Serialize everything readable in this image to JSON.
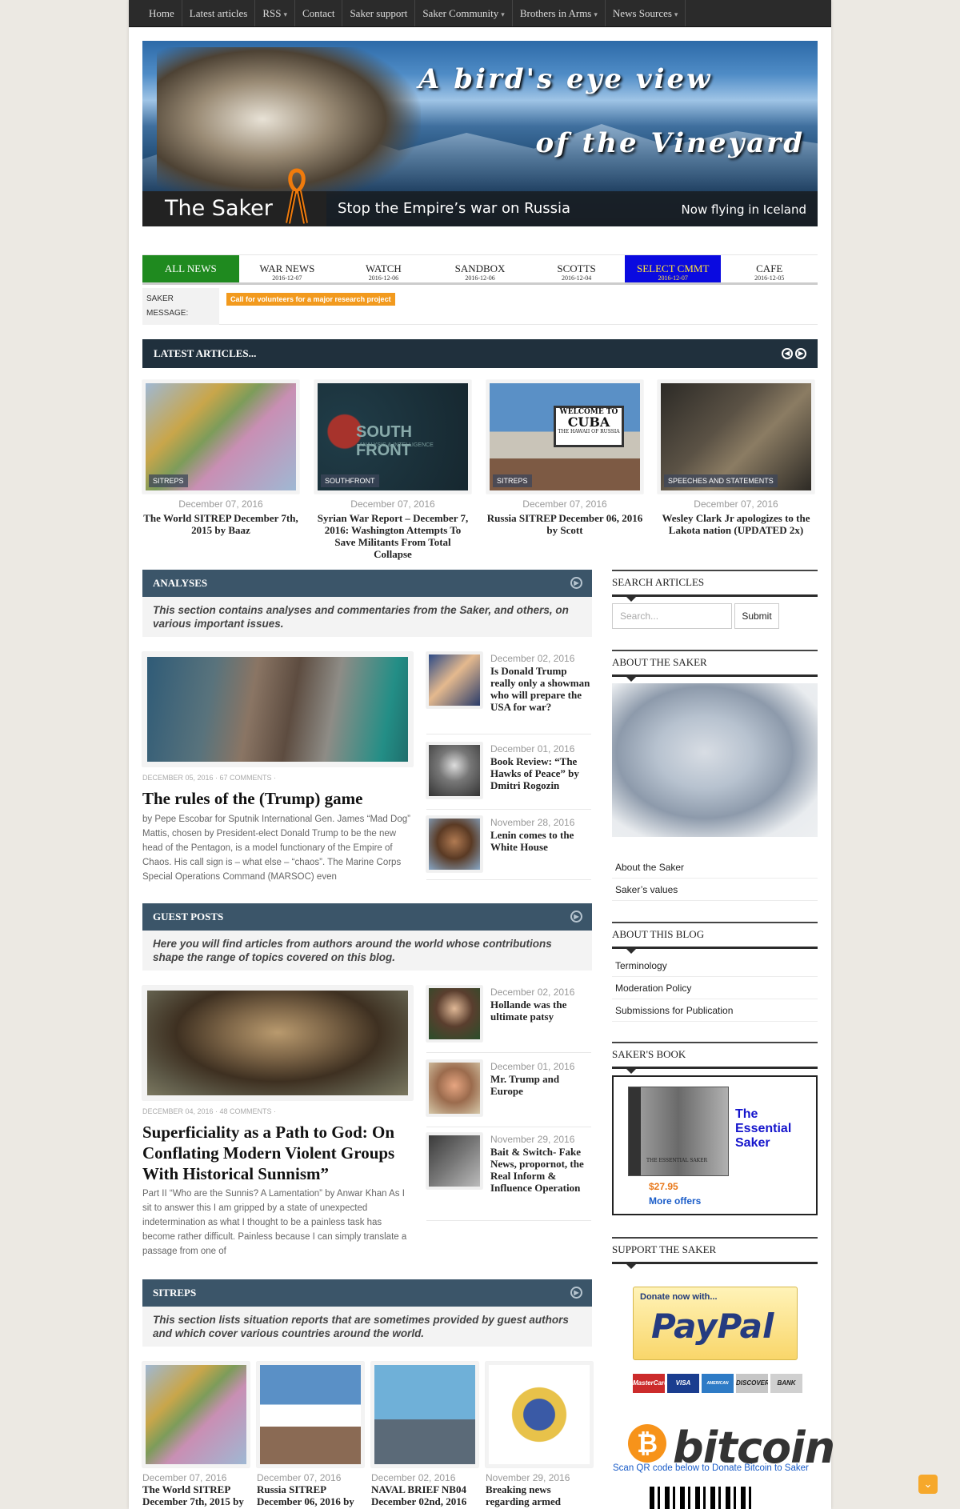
{
  "nav": [
    {
      "label": "Home",
      "dropdown": false
    },
    {
      "label": "Latest articles",
      "dropdown": false
    },
    {
      "label": "RSS",
      "dropdown": true
    },
    {
      "label": "Contact",
      "dropdown": false
    },
    {
      "label": "Saker support",
      "dropdown": false
    },
    {
      "label": "Saker Community",
      "dropdown": true
    },
    {
      "label": "Brothers in Arms",
      "dropdown": true
    },
    {
      "label": "News Sources",
      "dropdown": true
    }
  ],
  "banner": {
    "line1": "A bird's eye view",
    "line2": "of the Vineyard",
    "site_name": "The Saker",
    "slogan": "Stop the Empire’s war on Russia",
    "flying": "Now flying in Iceland"
  },
  "cats": [
    {
      "label": "ALL NEWS",
      "date": ""
    },
    {
      "label": "WAR NEWS",
      "date": "2016-12-07"
    },
    {
      "label": "WATCH",
      "date": "2016-12-06"
    },
    {
      "label": "SANDBOX",
      "date": "2016-12-06"
    },
    {
      "label": "SCOTTS",
      "date": "2016-12-04"
    },
    {
      "label": "SELECT CMMT",
      "date": "2016-12-07"
    },
    {
      "label": "CAFE",
      "date": "2016-12-05"
    }
  ],
  "message": {
    "label": "SAKER MESSAGE:",
    "text": "Call for volunteers for a major research project"
  },
  "latest": {
    "title": "LATEST ARTICLES...",
    "items": [
      {
        "cat": "SITREPS",
        "date": "December 07, 2016",
        "title": "The World SITREP December 7th, 2015 by Baaz"
      },
      {
        "cat": "SOUTHFRONT",
        "date": "December 07, 2016",
        "title": "Syrian War Report – December 7, 2016: Washington Attempts To Save Militants From Total Collapse"
      },
      {
        "cat": "SITREPS",
        "date": "December 07, 2016",
        "title": "Russia SITREP December 06, 2016 by Scott"
      },
      {
        "cat": "SPEECHES AND STATEMENTS",
        "date": "December 07, 2016",
        "title": "Wesley Clark Jr apologizes to the Lakota nation (UPDATED 2x)"
      }
    ],
    "img_text": {
      "southfront": "SOUTH FRONT",
      "southfront_sub": "ANALYSIS & INTELLIGENCE",
      "cuba1": "WELCOME TO",
      "cuba2": "CUBA",
      "cuba3": "THE HAWAII OF RUSSIA"
    }
  },
  "analyses": {
    "title": "ANALYSES",
    "desc": "This section contains analyses and commentaries from the Saker, and others, on various important issues.",
    "feature": {
      "meta": "December 05, 2016 · 67 Comments ·",
      "title": "The rules of the (Trump) game",
      "excerpt": "by Pepe Escobar for Sputnik International Gen. James “Mad Dog” Mattis, chosen by President-elect Donald Trump to be the new head of the Pentagon, is a model functionary of the Empire of Chaos. His call sign is – what else – “chaos”. The Marine Corps Special Operations Command (MARSOC) even"
    },
    "side": [
      {
        "date": "December 02, 2016",
        "title": "Is Donald Trump really only a showman who will prepare the USA for war?"
      },
      {
        "date": "December 01, 2016",
        "title": "Book Review: “The Hawks of Peace” by Dmitri Rogozin"
      },
      {
        "date": "November 28, 2016",
        "title": "Lenin comes to the White House"
      }
    ]
  },
  "guest": {
    "title": "GUEST POSTS",
    "desc": "Here you will find articles from authors around the world whose contributions shape the range of topics covered on this blog.",
    "feature": {
      "meta": "December 04, 2016 · 48 Comments ·",
      "title": "Superficiality as a Path to God: On Conflating Modern Violent Groups With Historical Sunnism”",
      "excerpt": "Part II “Who are the Sunnis? A Lamentation” by Anwar Khan As I sit to answer this I am gripped by a state of unexpected indetermination as what I thought to be a painless task has become rather difficult. Painless because I can simply translate a passage from one of"
    },
    "side": [
      {
        "date": "December 02, 2016",
        "title": "Hollande was the ultimate patsy"
      },
      {
        "date": "December 01, 2016",
        "title": "Mr. Trump and Europe"
      },
      {
        "date": "November 29, 2016",
        "title": "Bait & Switch- Fake News, propornot, the Real Inform & Influence Operation"
      }
    ]
  },
  "sitreps": {
    "title": "SITREPS",
    "desc": "This section lists situation reports that are sometimes provided by guest authors and which cover various countries around the world.",
    "items": [
      {
        "date": "December 07, 2016",
        "title": "The World SITREP December 7th, 2015 by"
      },
      {
        "date": "December 07, 2016",
        "title": "Russia SITREP December 06, 2016 by"
      },
      {
        "date": "December 02, 2016",
        "title": "NAVAL BRIEF NB04 December 02nd, 2016"
      },
      {
        "date": "November 29, 2016",
        "title": "Breaking news regarding armed"
      }
    ]
  },
  "sidebar": {
    "search_title": "SEARCH ARTICLES",
    "search_placeholder": "Search...",
    "submit": "Submit",
    "about_title": "ABOUT THE SAKER",
    "about_links": [
      "About the Saker",
      "Saker’s values"
    ],
    "blog_title": "ABOUT THIS BLOG",
    "blog_links": [
      "Terminology",
      "Moderation Policy",
      "Submissions for Publication"
    ],
    "book_title": "SAKER'S BOOK",
    "book": {
      "name": "The Essential Saker",
      "price": "$27.95",
      "offers": "More offers",
      "cover": "THE ESSENTIAL SAKER"
    },
    "support_title": "SUPPORT THE SAKER",
    "paypal_donate": "Donate now with...",
    "paypal_logo": "PayPal",
    "cards": [
      "MasterCard",
      "VISA",
      "AMERICAN EXPRESS",
      "DISCOVER",
      "BANK"
    ],
    "bitcoin_word": "bitcoin",
    "bitcoin_note": "Scan QR code below to Donate Bitcoin to Saker"
  },
  "colors": {
    "nav": "#2b2b2b",
    "all_news": "#1f8a1f",
    "select_cmmt": "#0a0ae0",
    "section": "#3b5569",
    "latest": "#20303d",
    "orange": "#f29a1e"
  }
}
